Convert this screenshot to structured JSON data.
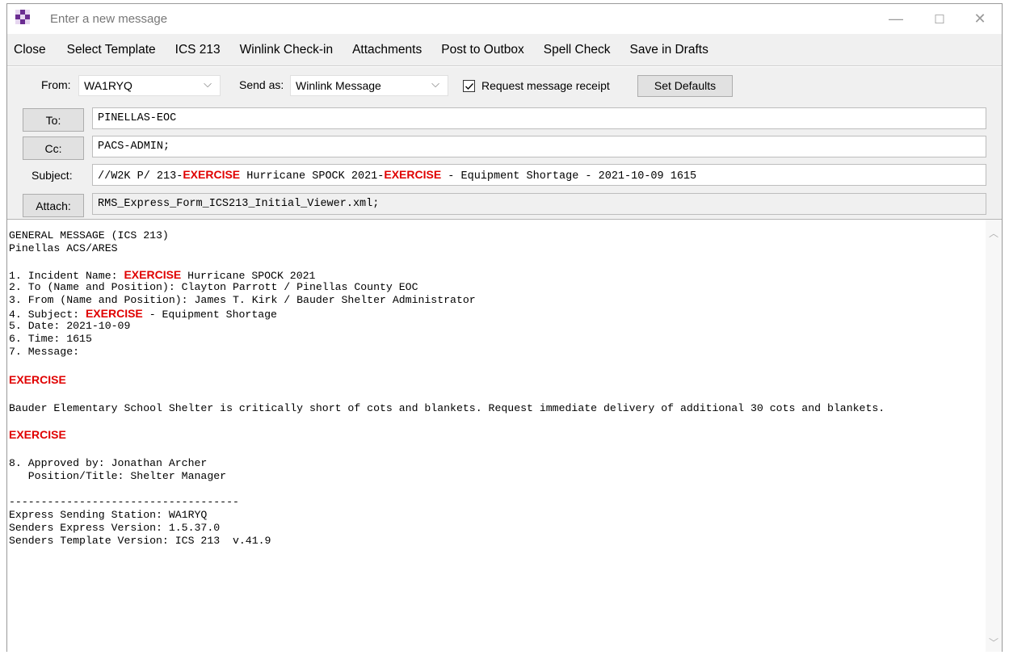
{
  "window": {
    "title": "Enter a new message",
    "controls": {
      "minimize": "—",
      "maximize": "☐",
      "close": "✕"
    }
  },
  "menu": [
    "Close",
    "Select Template",
    "ICS 213",
    "Winlink Check-in",
    "Attachments",
    "Post to Outbox",
    "Spell Check",
    "Save in Drafts"
  ],
  "header": {
    "from_label": "From:",
    "from_value": "WA1RYQ",
    "send_as_label": "Send as:",
    "send_as_value": "Winlink Message",
    "request_receipt_label": "Request message receipt",
    "request_receipt_checked": true,
    "set_defaults_label": "Set Defaults",
    "to_button": "To:",
    "to_value": "PINELLAS-EOC",
    "cc_button": "Cc:",
    "cc_value": "PACS-ADMIN;",
    "subject_label": "Subject:",
    "subject_parts": [
      "//W2K P/ 213-",
      "EXERCISE",
      " Hurricane SPOCK 2021-",
      "EXERCISE",
      " - Equipment Shortage - 2021-10-09 1615"
    ],
    "attach_button": "Attach:",
    "attach_value": "RMS_Express_Form_ICS213_Initial_Viewer.xml;"
  },
  "body": {
    "line1": "GENERAL MESSAGE (ICS 213)",
    "line2": "Pinellas ACS/ARES",
    "item1_prefix": "1. Incident Name: ",
    "item1_ex": "EXERCISE",
    "item1_suffix": " Hurricane SPOCK 2021",
    "item2": "2. To (Name and Position): Clayton Parrott / Pinellas County EOC",
    "item3": "3. From (Name and Position): James T. Kirk / Bauder Shelter Administrator",
    "item4_prefix": "4. Subject: ",
    "item4_ex": "EXERCISE",
    "item4_suffix": " - Equipment Shortage",
    "item5": "5. Date: 2021-10-09",
    "item6": "6. Time: 1615",
    "item7": "7. Message:",
    "exercise_top": "EXERCISE",
    "message": "Bauder Elementary School Shelter is critically short of cots and blankets. Request immediate delivery of additional 30 cots and blankets.",
    "exercise_bottom": "EXERCISE",
    "item8": "8. Approved by: Jonathan Archer",
    "item8_position": "   Position/Title: Shelter Manager",
    "divider": "------------------------------------",
    "station": "Express Sending Station: WA1RYQ",
    "express_version": "Senders Express Version: 1.5.37.0",
    "template_version": "Senders Template Version: ICS 213  v.41.9"
  },
  "colors": {
    "exercise": "#e00000",
    "panel": "#f0f0f0"
  },
  "icons": [
    "app-icon",
    "chevron-down-icon",
    "checkmark-icon",
    "scroll-up-icon",
    "scroll-down-icon"
  ]
}
